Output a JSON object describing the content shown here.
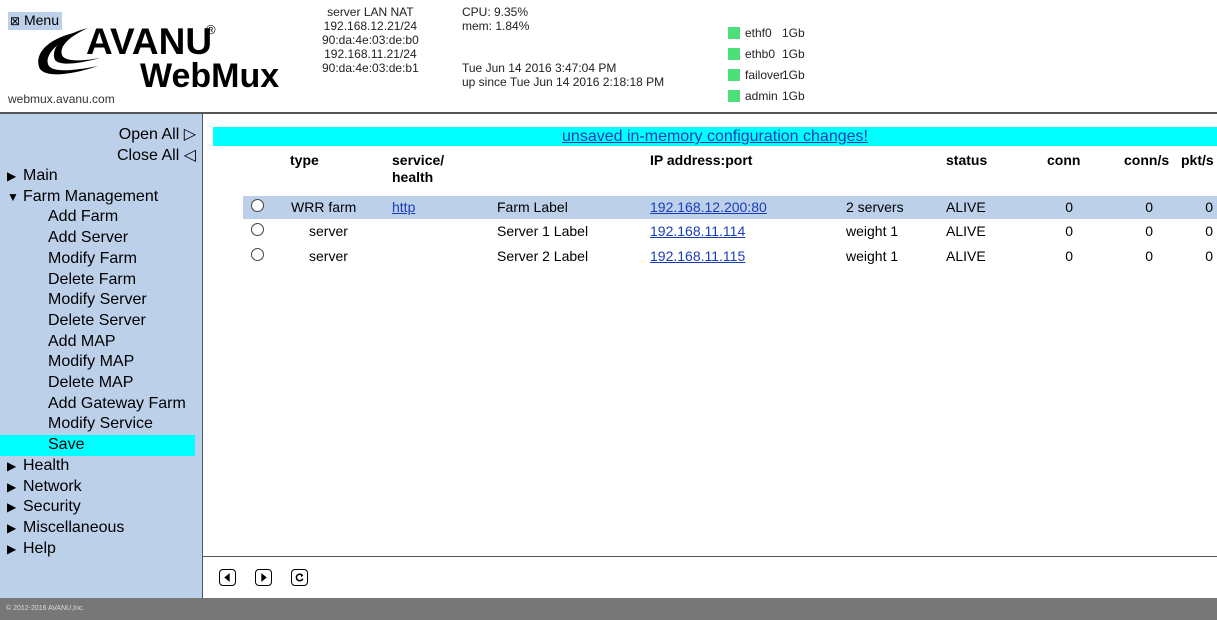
{
  "header": {
    "menu_label": "Menu",
    "brand_top": "AVANU",
    "brand_reg": "®",
    "brand_bottom": "WebMux",
    "url": "webmux.avanu.com",
    "server_info": [
      "server LAN NAT",
      "192.168.12.21/24",
      "90:da:4e:03:de:b0",
      "192.168.11.21/24",
      "90:da:4e:03:de:b1"
    ],
    "cpu": "CPU: 9.35%",
    "mem": "mem: 1.84%",
    "datetime": "Tue Jun 14 2016 3:47:04 PM",
    "uptime": "up since Tue Jun 14 2016 2:18:18 PM",
    "interfaces": [
      {
        "name": "ethf0",
        "speed": "1Gb"
      },
      {
        "name": "ethb0",
        "speed": "1Gb"
      },
      {
        "name": "failover",
        "speed": "1Gb"
      },
      {
        "name": "admin",
        "speed": "1Gb"
      }
    ],
    "status_color": "#4ce07a"
  },
  "sidebar": {
    "open_all": "Open All ▷",
    "close_all": "Close All ◁",
    "sections": [
      {
        "label": "Main",
        "arrow": "▶"
      },
      {
        "label": "Farm Management",
        "arrow": "▼"
      }
    ],
    "farm_items": [
      "Add Farm",
      "Add Server",
      "Modify Farm",
      "Delete Farm",
      "Modify Server",
      "Delete Server",
      "Add MAP",
      "Modify MAP",
      "Delete MAP",
      "Add Gateway Farm",
      "Modify Service",
      "Save"
    ],
    "after_sections": [
      {
        "label": "Health",
        "arrow": "▶"
      },
      {
        "label": "Network",
        "arrow": "▶"
      },
      {
        "label": "Security",
        "arrow": "▶"
      },
      {
        "label": "Miscellaneous",
        "arrow": "▶"
      },
      {
        "label": "Help",
        "arrow": "▶"
      }
    ],
    "active_item": "Save",
    "bg_color": "#bcd0ea",
    "active_color": "#00ffff"
  },
  "main": {
    "banner": "unsaved in-memory configuration changes!",
    "columns": {
      "type": "type",
      "service": "service/",
      "health": "health",
      "ip": "IP address:port",
      "status": "status",
      "conn": "conn",
      "conn_s": "conn/s",
      "pkt_s": "pkt/s"
    },
    "rows": [
      {
        "type": "WRR farm",
        "service": "http",
        "label": "Farm Label",
        "ip": "192.168.12.200:80",
        "info": "2 servers",
        "status": "ALIVE",
        "conn": "0",
        "conn_s": "0",
        "pkt_s": "0"
      },
      {
        "type": "server",
        "service": "",
        "label": "Server 1 Label",
        "ip": "192.168.11.114",
        "info": "weight 1",
        "status": "ALIVE",
        "conn": "0",
        "conn_s": "0",
        "pkt_s": "0"
      },
      {
        "type": "server",
        "service": "",
        "label": "Server 2 Label",
        "ip": "192.168.11.115",
        "info": "weight 1",
        "status": "ALIVE",
        "conn": "0",
        "conn_s": "0",
        "pkt_s": "0"
      }
    ],
    "nav": [
      {
        "name": "back-icon",
        "glyph": "◀"
      },
      {
        "name": "forward-icon",
        "glyph": "▶"
      },
      {
        "name": "refresh-icon",
        "glyph": "↻"
      }
    ]
  },
  "footer": {
    "text": "© 2012-2016 AVANU,Inc."
  }
}
